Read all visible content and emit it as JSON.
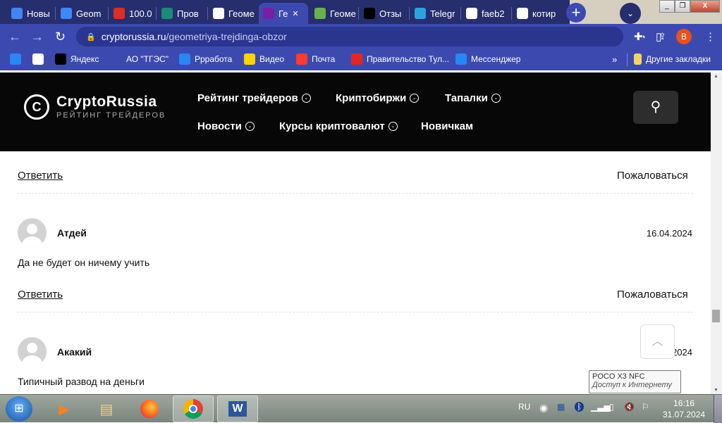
{
  "browser": {
    "tabs": [
      {
        "label": "Новы",
        "icon": "google-docs-icon",
        "color": "#4285f4"
      },
      {
        "label": "Geom",
        "icon": "google-docs-icon",
        "color": "#4285f4"
      },
      {
        "label": "100.0",
        "icon": "copyright-icon",
        "color": "#d93025"
      },
      {
        "label": "Пров",
        "icon": "m-site-icon",
        "color": "#1a8a7a"
      },
      {
        "label": "Геоме",
        "icon": "google-icon",
        "color": "#ffffff"
      },
      {
        "label": "Ге",
        "icon": "cryptorussia-icon",
        "color": "#7b1fa2",
        "active": true
      },
      {
        "label": "Геоме",
        "icon": "gear-green-icon",
        "color": "#6ab04c"
      },
      {
        "label": "Отзы",
        "icon": "otzovik-icon",
        "color": "#000000"
      },
      {
        "label": "Telegr",
        "icon": "telegram-icon",
        "color": "#2aa3e0"
      },
      {
        "label": "faeb2",
        "icon": "globe-icon",
        "color": "#ffffff"
      },
      {
        "label": "котир",
        "icon": "google-icon",
        "color": "#ffffff"
      }
    ],
    "url_host": "cryptorussia.ru",
    "url_path": "/geometriya-trejdinga-obzor",
    "profile_initial": "B",
    "bookmarks": [
      {
        "label": "",
        "icon": "vk-icon"
      },
      {
        "label": "",
        "icon": "globe-icon"
      },
      {
        "label": "Яндекс",
        "icon": "yandex-icon"
      },
      {
        "label": "АО \"ТГЭС\"",
        "icon": "tges-icon"
      },
      {
        "label": "Ррработа",
        "icon": "message-icon"
      },
      {
        "label": "Видео",
        "icon": "play-icon"
      },
      {
        "label": "Почта",
        "icon": "mail-icon"
      },
      {
        "label": "Правительство Тул...",
        "icon": "tula-gov-icon"
      },
      {
        "label": "Мессенджер",
        "icon": "message-icon"
      }
    ],
    "more_bookmarks": "»",
    "other_bookmarks": "Другие закладки"
  },
  "site": {
    "logo_title": "CryptoRussia",
    "logo_subtitle": "РЕЙТИНГ ТРЕЙДЕРОВ",
    "nav": [
      {
        "label": "Рейтинг трейдеров",
        "dropdown": true
      },
      {
        "label": "Криптобиржи",
        "dropdown": true
      },
      {
        "label": "Тапалки",
        "dropdown": true
      },
      {
        "label": "Новости",
        "dropdown": true
      },
      {
        "label": "Курсы криптовалют",
        "dropdown": true
      },
      {
        "label": "Новичкам",
        "dropdown": false
      }
    ]
  },
  "comments": {
    "reply_label": "Ответить",
    "report_label": "Пожаловаться",
    "items": [
      {
        "author": "Атдей",
        "date": "16.04.2024",
        "text": "Да не будет он ничему учить"
      },
      {
        "author": "Акакий",
        "date": "…2024",
        "text": "Типичный развод на деньги"
      }
    ]
  },
  "tooltip": {
    "title": "POCO X3 NFC",
    "subtitle": "Доступ к Интернету"
  },
  "taskbar": {
    "lang": "RU",
    "time": "16:16",
    "date": "31.07.2024"
  }
}
